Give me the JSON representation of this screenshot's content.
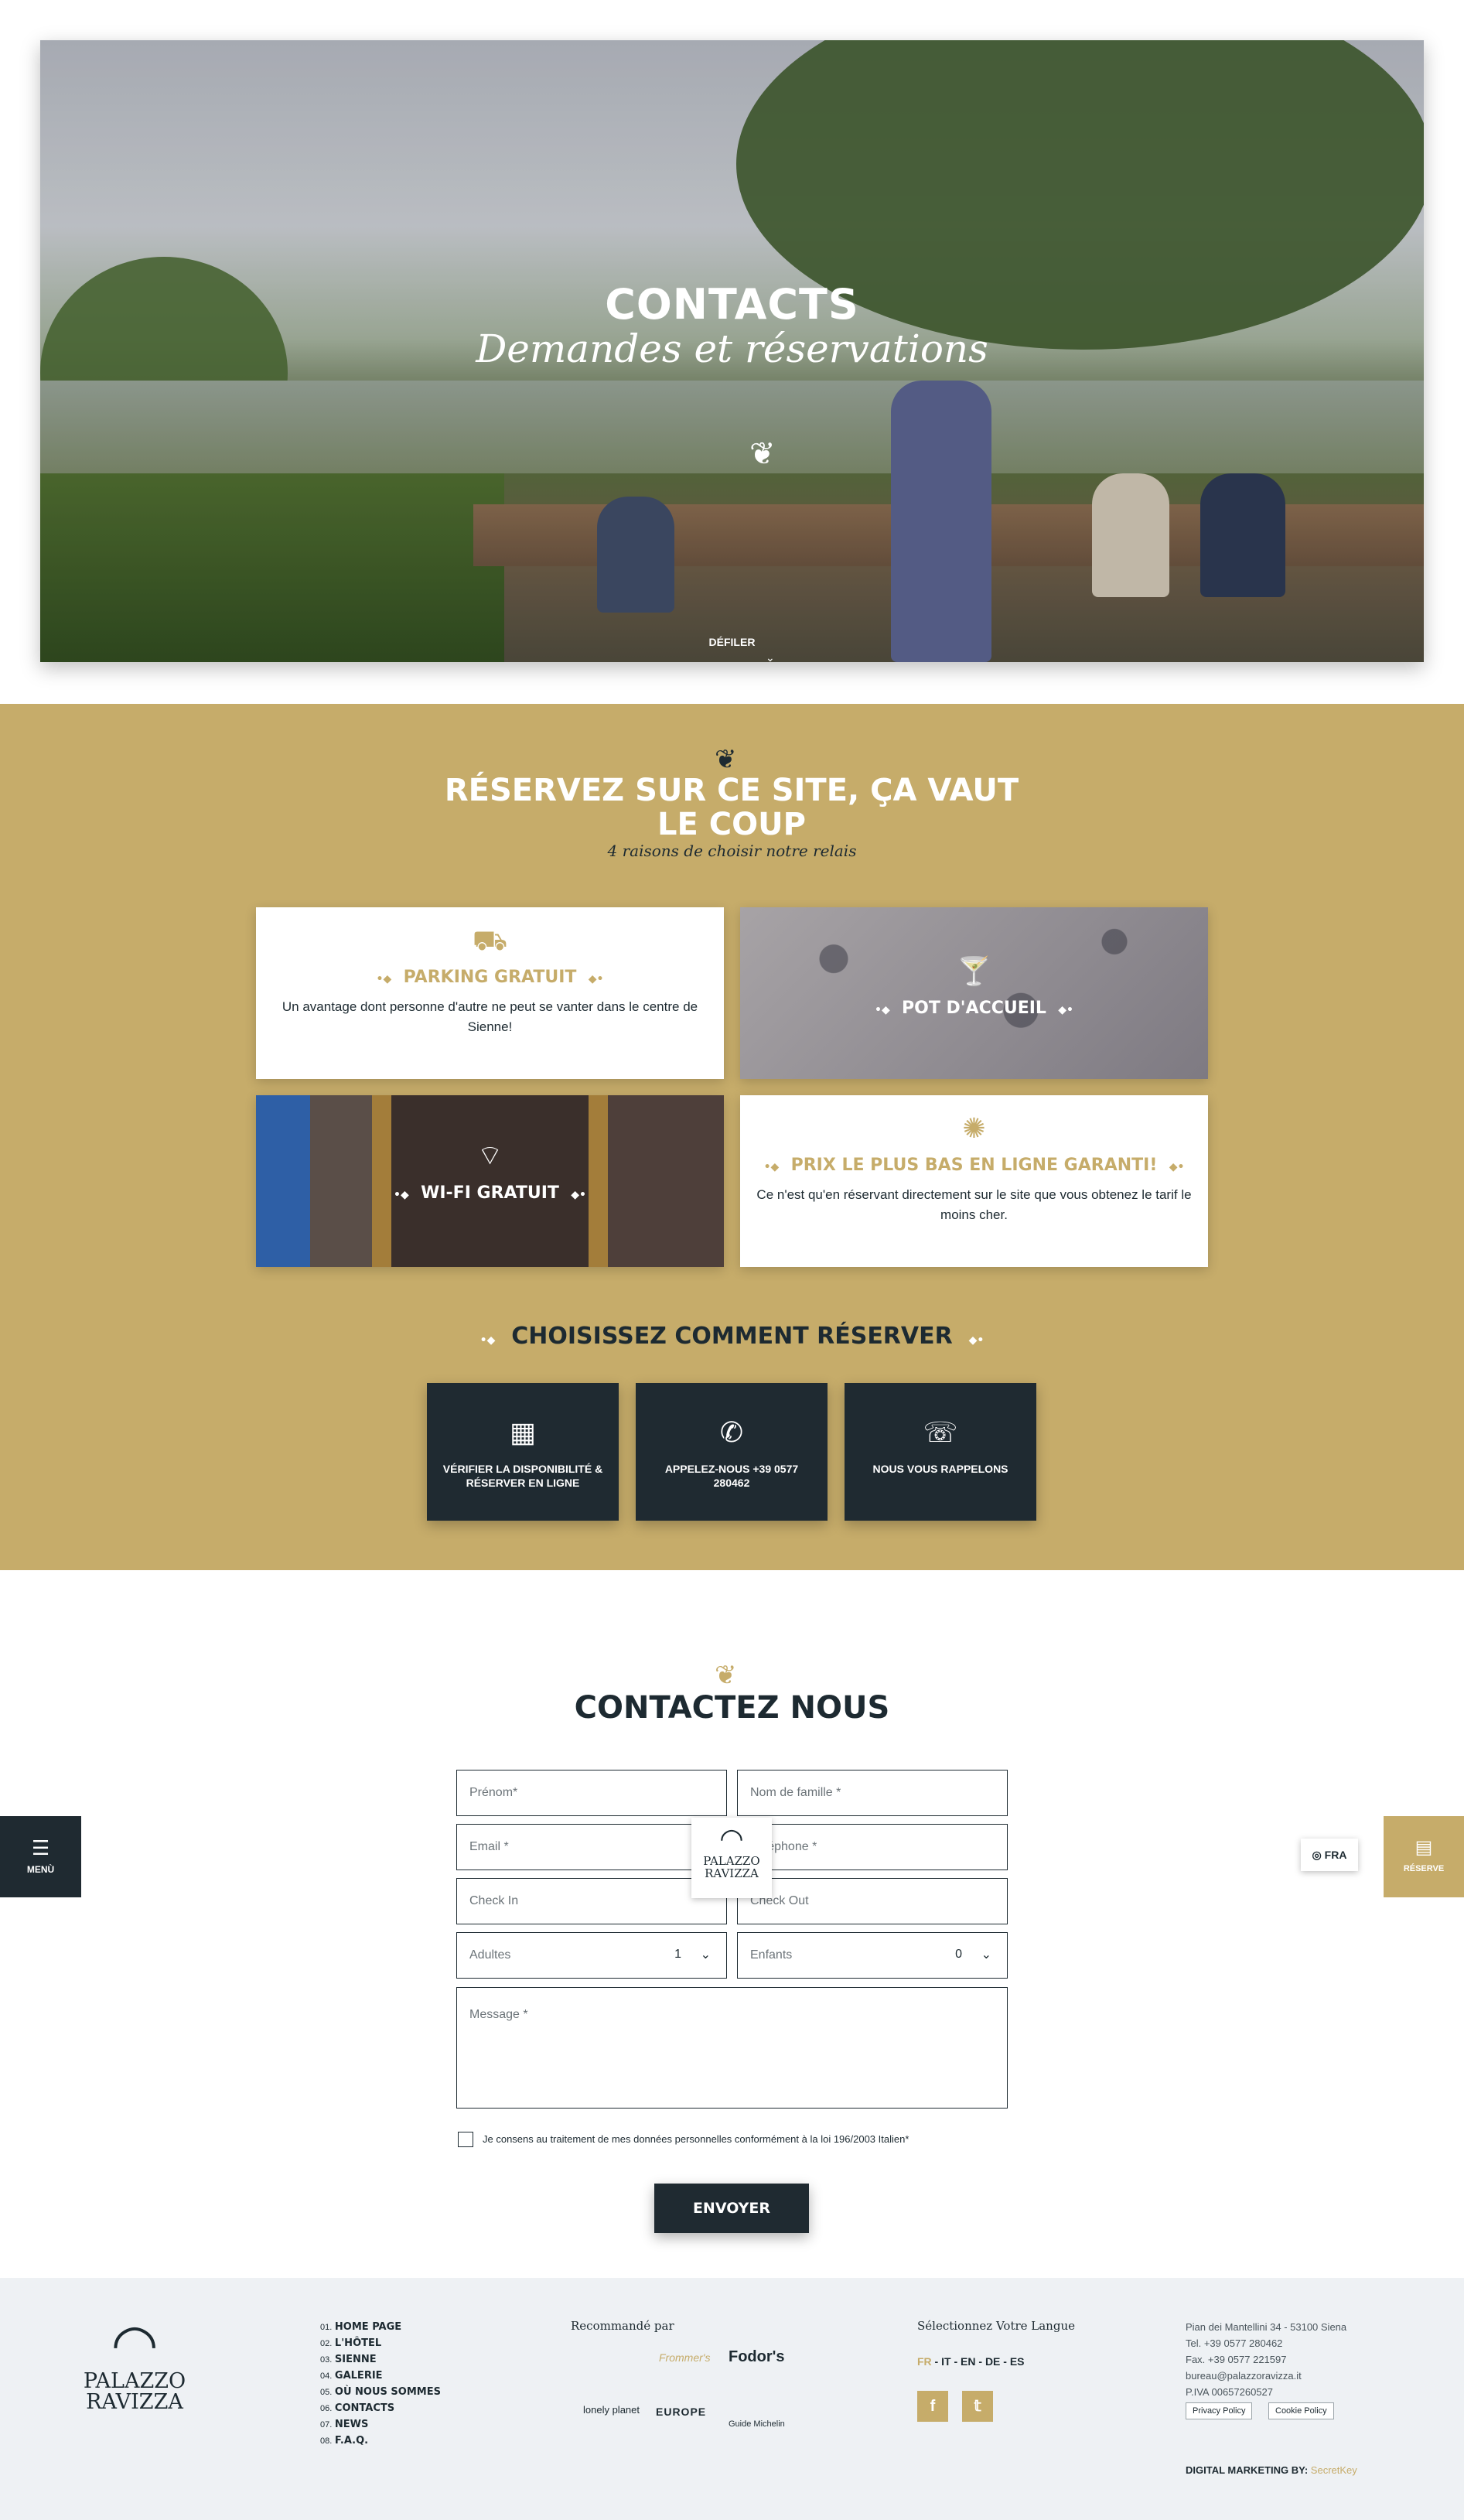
{
  "hero": {
    "title": "CONTACTS",
    "subtitle": "Demandes et réservations",
    "scroll_label": "DÉFILER"
  },
  "reasons": {
    "title": "RÉSERVEZ SUR CE SITE, ÇA VAUT LE COUP",
    "subtitle": "4 raisons de choisir notre relais",
    "cards": [
      {
        "title": "PARKING GRATUIT",
        "text": "Un avantage dont personne d'autre ne peut se vanter dans le centre de Sienne!"
      },
      {
        "title": "POT D'ACCUEIL"
      },
      {
        "title": "WI-FI GRATUIT"
      },
      {
        "title": "PRIX LE PLUS BAS EN LIGNE GARANTI!",
        "text": "Ce n'est qu'en réservant directement sur le site que vous obtenez le tarif le moins cher."
      }
    ]
  },
  "booking": {
    "title": "CHOISISSEZ COMMENT RÉSERVER",
    "buttons": [
      {
        "label": "VÉRIFIER LA DISPONIBILITÉ & RÉSERVER EN LIGNE"
      },
      {
        "label": "APPELEZ-NOUS +39 0577 280462"
      },
      {
        "label": "NOUS VOUS RAPPELONS"
      }
    ]
  },
  "contact": {
    "title": "CONTACTEZ NOUS",
    "fields": {
      "first_name": "Prénom*",
      "last_name": "Nom de famille *",
      "email": "Email *",
      "phone": "Téléphone *",
      "check_in": "Check In",
      "check_out": "Check Out",
      "adults_label": "Adultes",
      "adults_value": "1",
      "children_label": "Enfants",
      "children_value": "0",
      "message": "Message *"
    },
    "consent": "Je consens au traitement de mes données personnelles conformément à la loi 196/2003 Italien*",
    "submit": "ENVOYER"
  },
  "floating": {
    "menu_label": "MENÙ",
    "reserve_label": "RÉSERVE",
    "lang_label": "FRA",
    "logo_line1": "PALAZZO",
    "logo_line2": "RAVIZZA"
  },
  "footer": {
    "logo_line1": "PALAZZO",
    "logo_line2": "RAVIZZA",
    "nav": [
      {
        "num": "01.",
        "label": "HOME PAGE"
      },
      {
        "num": "02.",
        "label": "L'HÔTEL"
      },
      {
        "num": "03.",
        "label": "SIENNE"
      },
      {
        "num": "04.",
        "label": "GALERIE"
      },
      {
        "num": "05.",
        "label": "OÙ NOUS SOMMES"
      },
      {
        "num": "06.",
        "label": "CONTACTS"
      },
      {
        "num": "07.",
        "label": "NEWS"
      },
      {
        "num": "08.",
        "label": "F.A.Q."
      }
    ],
    "recommended_title": "Recommandé par",
    "press": [
      "Frommer's",
      "Fodor's",
      "lonely planet",
      "EUROPE",
      "Guide Michelin"
    ],
    "language_title": "Sélectionnez Votre Langue",
    "languages": [
      "FR",
      "IT",
      "EN",
      "DE",
      "ES"
    ],
    "address": "Pian dei Mantellini 34 - 53100 Siena",
    "tel": "Tel. +39 0577 280462",
    "fax": "Fax. +39 0577 221597",
    "email": "bureau@palazzoravizza.it",
    "vat": "P.IVA 00657260527",
    "privacy": "Privacy Policy",
    "cookie": "Cookie Policy",
    "credit_label": "DIGITAL MARKETING BY:",
    "credit_brand": "SecretKey"
  },
  "colors": {
    "gold": "#c6ac6a",
    "navy": "#1f2a31",
    "footer_bg": "#eef1f4"
  }
}
